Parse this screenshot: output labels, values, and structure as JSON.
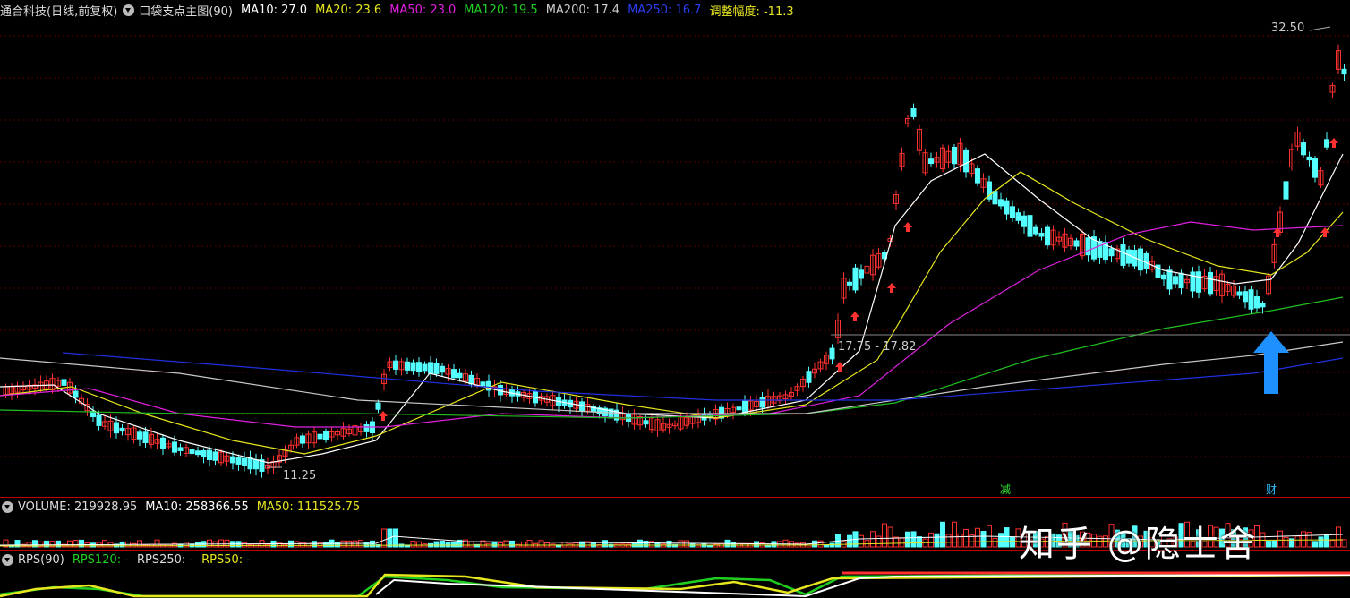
{
  "header": {
    "stock": "通合科技(日线,前复权)",
    "indicator": "口袋支点主图(90)",
    "ma10": "MA10: 27.0",
    "ma20": "MA20: 23.6",
    "ma50": "MA50: 23.0",
    "ma120": "MA120: 19.5",
    "ma200": "MA200: 17.4",
    "ma250": "MA250: 16.7",
    "adjust": "调整幅度: -11.3"
  },
  "annotations": {
    "high": "32.50",
    "low": "11.25",
    "range": "17.75 - 17.82",
    "marker_reduce": "减",
    "marker_finance": "财"
  },
  "volume_bar": {
    "volume": "VOLUME: 219928.95",
    "ma10": "MA10: 258366.55",
    "ma50": "MA50: 111525.75"
  },
  "rps_bar": {
    "rps": "RPS(90)",
    "rps120": "RPS120: -",
    "rps250": "RPS250: -",
    "rps50": "RPS50: -"
  },
  "watermark": "知乎 @隐士舍",
  "colors": {
    "up": "#ff3030",
    "down": "#54ffff",
    "ma10": "#ffffff",
    "ma20": "#e6e61e",
    "ma50": "#e020e0",
    "ma120": "#20c020",
    "ma200": "#c8c8c8",
    "ma250": "#2030e0",
    "arrow": "#1e90ff"
  }
}
